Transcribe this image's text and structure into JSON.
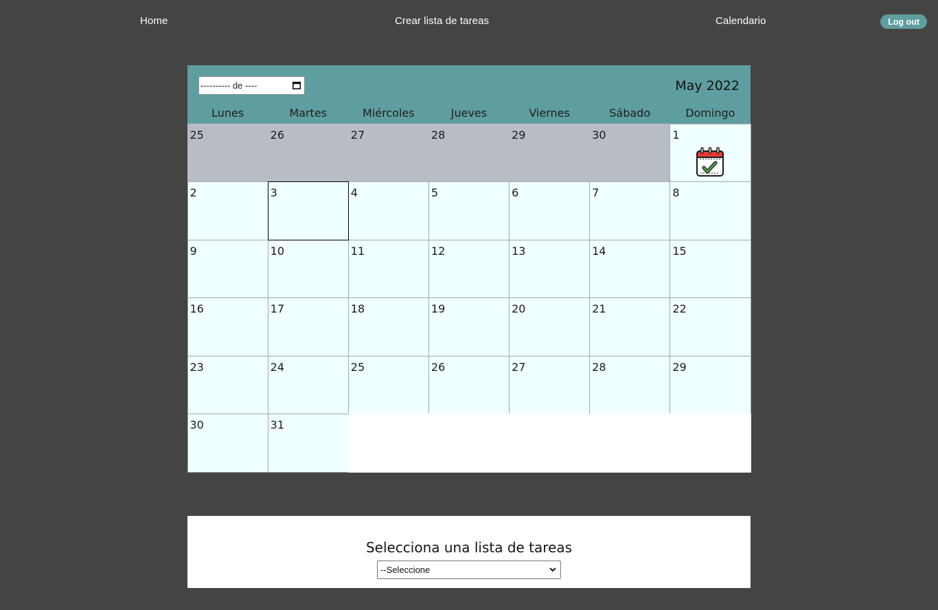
{
  "nav": {
    "home": "Home",
    "create_list": "Crear lista de tareas",
    "calendar": "Calendario",
    "logout": "Log out"
  },
  "calendar": {
    "date_input_placeholder": "---------- de ----",
    "month_title": "May 2022",
    "weekdays": [
      "Lunes",
      "Martes",
      "Miércoles",
      "Jueves",
      "Viernes",
      "Sábado",
      "Domingo"
    ],
    "weeks": [
      [
        "25",
        "26",
        "27",
        "28",
        "29",
        "30",
        "1"
      ],
      [
        "2",
        "3",
        "4",
        "5",
        "6",
        "7",
        "8"
      ],
      [
        "9",
        "10",
        "11",
        "12",
        "13",
        "14",
        "15"
      ],
      [
        "16",
        "17",
        "18",
        "19",
        "20",
        "21",
        "22"
      ],
      [
        "23",
        "24",
        "25",
        "26",
        "27",
        "28",
        "29"
      ],
      [
        "30",
        "31",
        "",
        "",
        "",
        "",
        ""
      ]
    ],
    "today": "3",
    "event_icon": "calendar-check-icon"
  },
  "lists": {
    "title": "Selecciona una lista de tareas",
    "selected": "--Seleccione"
  },
  "colors": {
    "background": "#444443",
    "accent": "#5f9ea0",
    "day_cell": "#f0ffff",
    "prev_month_cell": "#b8bcc5"
  }
}
